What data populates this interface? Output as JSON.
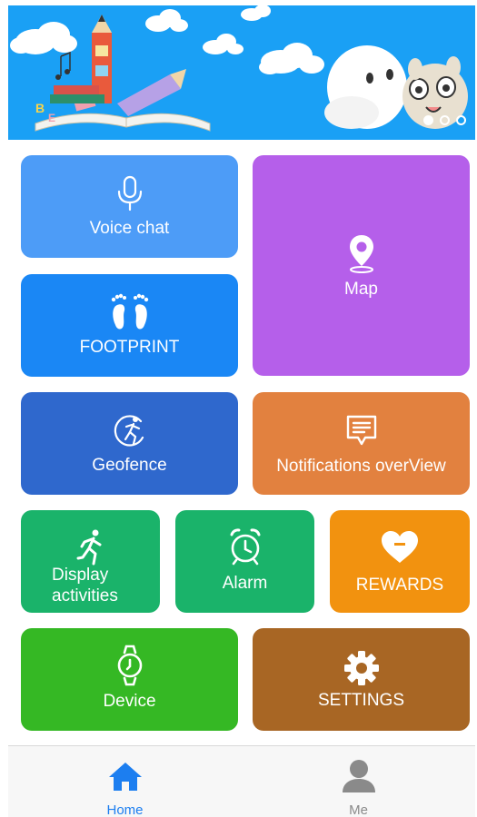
{
  "colors": {
    "banner_bg": "#1aa0f5",
    "voice_chat": "#4d9cf7",
    "map": "#b55fea",
    "footprint": "#1a87f5",
    "geofence": "#2f68cd",
    "notifications": "#e2813f",
    "display_activities": "#1ab36a",
    "alarm": "#1ab36a",
    "rewards": "#f2920f",
    "device": "#35b824",
    "settings": "#a86624",
    "tab_active": "#1c7ef0",
    "tab_inactive": "#8a8a8a"
  },
  "banner": {
    "carousel_pages": 3,
    "active_page": 1
  },
  "tiles": {
    "voice_chat": {
      "label": "Voice chat",
      "icon": "microphone-icon"
    },
    "map": {
      "label": "Map",
      "icon": "location-pin-icon"
    },
    "footprint": {
      "label": "FOOTPRINT",
      "icon": "footprints-icon"
    },
    "geofence": {
      "label": "Geofence",
      "icon": "runner-circle-icon"
    },
    "notifications": {
      "label": "Notifications overView",
      "icon": "message-icon"
    },
    "display_activities": {
      "label_line1": "Display",
      "label_line2": "activities",
      "icon": "runner-icon"
    },
    "alarm": {
      "label": "Alarm",
      "icon": "alarm-clock-icon"
    },
    "rewards": {
      "label": "REWARDS",
      "icon": "heart-icon"
    },
    "device": {
      "label": "Device",
      "icon": "watch-icon"
    },
    "settings": {
      "label": "SETTINGS",
      "icon": "gear-icon"
    }
  },
  "tabbar": {
    "home": {
      "label": "Home",
      "icon": "home-icon",
      "active": true
    },
    "me": {
      "label": "Me",
      "icon": "person-icon",
      "active": false
    }
  }
}
